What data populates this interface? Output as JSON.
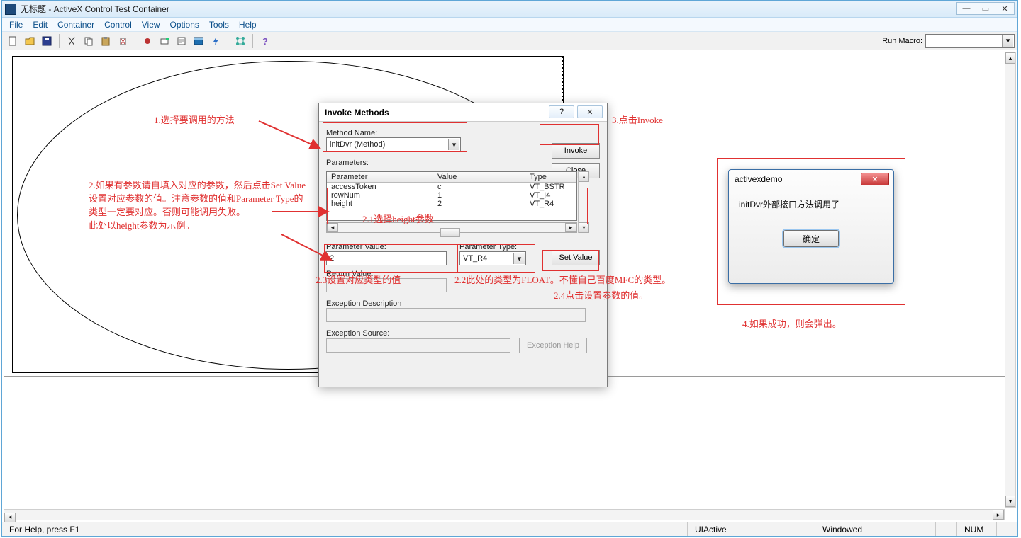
{
  "window": {
    "title": "无标题 - ActiveX Control Test Container",
    "controls": {
      "min": "—",
      "restore": "▭",
      "close": "✕"
    }
  },
  "menu": {
    "file": "File",
    "edit": "Edit",
    "container": "Container",
    "control": "Control",
    "view": "View",
    "options": "Options",
    "tools": "Tools",
    "help": "Help"
  },
  "toolbar": {
    "run_macro_label": "Run Macro:"
  },
  "dialog": {
    "title": "Invoke Methods",
    "help_sym": "?",
    "close_sym": "✕",
    "method_name_label": "Method Name:",
    "method_value": "initDvr (Method)",
    "invoke": "Invoke",
    "close": "Close",
    "parameters_label": "Parameters:",
    "headers": {
      "parameter": "Parameter",
      "value": "Value",
      "type": "Type"
    },
    "rows": [
      {
        "parameter": "accessToken",
        "value": "c",
        "type": "VT_BSTR"
      },
      {
        "parameter": "rowNum",
        "value": "1",
        "type": "VT_I4"
      },
      {
        "parameter": "height",
        "value": "2",
        "type": "VT_R4"
      }
    ],
    "parameter_value_label": "Parameter Value:",
    "parameter_value": "2",
    "parameter_type_label": "Parameter Type:",
    "parameter_type": "VT_R4",
    "set_value": "Set Value",
    "return_value_label": "Return Value:",
    "exception_desc_label": "Exception Description",
    "exception_src_label": "Exception Source:",
    "exception_help": "Exception Help"
  },
  "annotations": {
    "a1": "1.选择要调用的方法",
    "a2": "2.如果有参数请自填入对应的参数，然后点击Set Value 设置对应参数的值。注意参数的值和Parameter Type的类型一定要对应。否则可能调用失败。\n此处以height参数为示例。",
    "a21": "2.1选择height参数",
    "a22": "2.2此处的类型为FLOAT。不懂自己百度MFC的类型。",
    "a23": "2.3设置对应类型的值",
    "a24": "2.4点击设置参数的值。",
    "a3": "3.点击Invoke",
    "a4": "4.如果成功，则会弹出。"
  },
  "popup": {
    "title": "activexdemo",
    "message": "initDvr外部接口方法调用了",
    "ok": "确定",
    "close_sym": "✕"
  },
  "status": {
    "help": "For Help, press F1",
    "uiactive": "UIActive",
    "windowed": "Windowed",
    "num": "NUM"
  }
}
